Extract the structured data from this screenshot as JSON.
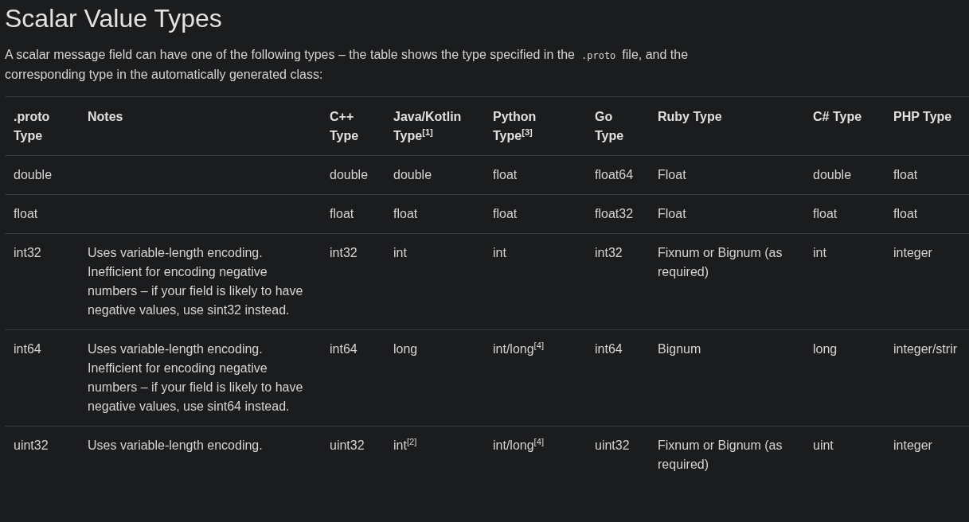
{
  "title": "Scalar Value Types",
  "intro": {
    "before": "A scalar message field can have one of the following types – the table shows the type specified in the",
    "code": ".proto",
    "after": "file, and the corresponding type in the automatically generated class:"
  },
  "table": {
    "columns": [
      ".proto Type",
      "Notes",
      "C++ Type",
      "Java/Kotlin Type$^{[1]}$",
      "Python Type$^{[3]}$",
      "Go Type",
      "Ruby Type",
      "C# Type",
      "PHP Type"
    ],
    "rows": [
      [
        "double",
        "",
        "double",
        "double",
        "float",
        "float64",
        "Float",
        "double",
        "float"
      ],
      [
        "float",
        "",
        "float",
        "float",
        "float",
        "float32",
        "Float",
        "float",
        "float"
      ],
      [
        "int32",
        "Uses variable-length encoding. Inefficient for encoding negative numbers – if your field is likely to have negative values, use sint32 instead.",
        "int32",
        "int",
        "int",
        "int32",
        "Fixnum or Bignum (as required)",
        "int",
        "integer"
      ],
      [
        "int64",
        "Uses variable-length encoding. Inefficient for encoding negative numbers – if your field is likely to have negative values, use sint64 instead.",
        "int64",
        "long",
        "int/long$^{[4]}$",
        "int64",
        "Bignum",
        "long",
        "integer/strir"
      ],
      [
        "uint32",
        "Uses variable-length encoding.",
        "uint32",
        "int$^{[2]}$",
        "int/long$^{[4]}$",
        "uint32",
        "Fixnum or Bignum (as required)",
        "uint",
        "integer"
      ]
    ]
  }
}
